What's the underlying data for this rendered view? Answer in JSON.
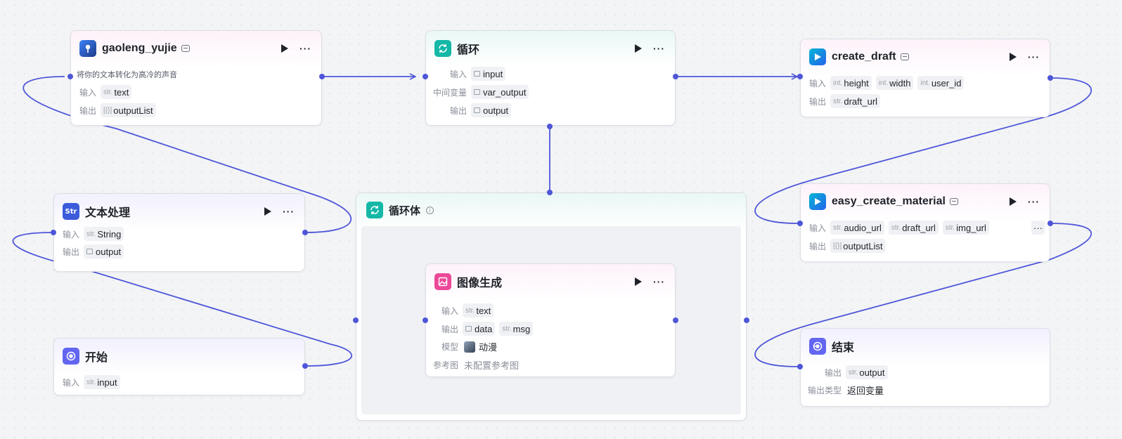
{
  "nodes": {
    "gaoleng": {
      "title": "gaoleng_yujie",
      "desc": "将你的文本转化为高冷的声音",
      "in_label": "输入",
      "in_type": "str.",
      "in_name": "text",
      "out_label": "输出",
      "out_type": "[{}]",
      "out_name": "outputList"
    },
    "loop": {
      "title": "循环",
      "in_label": "输入",
      "in_name": "input",
      "var_label": "中间变量",
      "var_name": "var_output",
      "out_label": "输出",
      "out_name": "output"
    },
    "create_draft": {
      "title": "create_draft",
      "in_label": "输入",
      "int_type": "int.",
      "in_1": "height",
      "in_2": "width",
      "in_3": "user_id",
      "out_label": "输出",
      "out_type": "str.",
      "out_name": "draft_url"
    },
    "text_proc": {
      "title": "文本处理",
      "in_label": "输入",
      "in_type": "str.",
      "in_name": "String",
      "out_label": "输出",
      "out_name": "output"
    },
    "loop_body": {
      "title": "循环体"
    },
    "easy_material": {
      "title": "easy_create_material",
      "in_label": "输入",
      "str_type": "str.",
      "in_1": "audio_url",
      "in_2": "draft_url",
      "in_3": "img_url",
      "in_more": "···",
      "out_label": "输出",
      "out_type": "[{}]",
      "out_name": "outputList"
    },
    "image_gen": {
      "title": "图像生成",
      "in_label": "输入",
      "in_type": "str.",
      "in_name": "text",
      "out_label": "输出",
      "out_1": "data",
      "out_type": "str.",
      "out_2": "msg",
      "model_label": "模型",
      "model_value": "动漫",
      "ref_label": "参考图",
      "ref_value": "未配置参考图"
    },
    "start": {
      "title": "开始",
      "in_label": "输入",
      "in_type": "str.",
      "in_name": "input"
    },
    "end": {
      "title": "结束",
      "out_label": "输出",
      "out_type": "str.",
      "out_name": "output",
      "type_label": "输出类型",
      "type_value": "返回变量"
    }
  },
  "icons": {
    "gaoleng": "voice-avatar-icon",
    "loop": "loop-icon",
    "plugin": "play-plugin-icon",
    "text": "text-process-icon",
    "image": "image-generate-icon",
    "start": "start-icon",
    "end": "end-icon",
    "run": "run-icon",
    "more": "more-icon",
    "info": "info-icon"
  },
  "colors": {
    "edge": "#4e56d8",
    "loop_teal": "#14b8a6",
    "plugin_blue": "#1677ff",
    "text_blue": "#3b5bdb",
    "image_pink": "#ec4899",
    "start_purple": "#6366f1"
  }
}
